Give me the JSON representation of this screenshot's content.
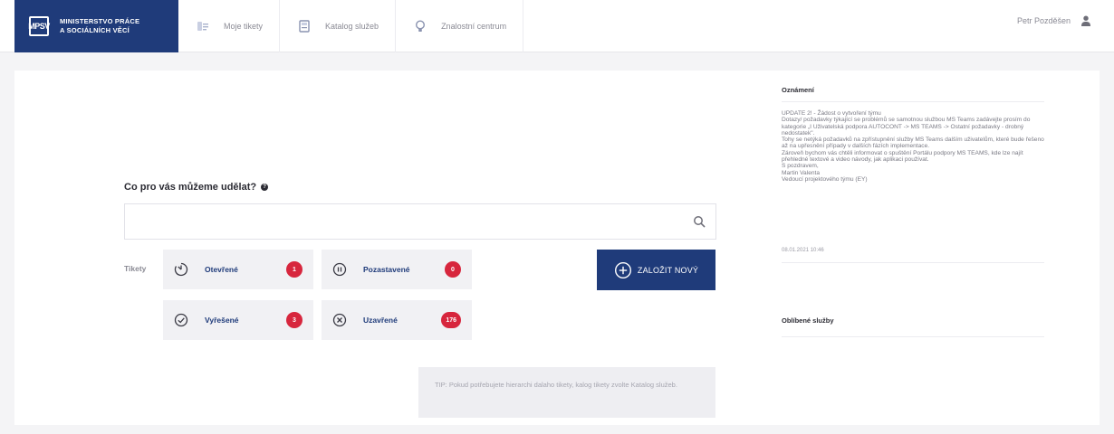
{
  "header": {
    "logo_mark": "MPSV",
    "logo_line1": "MINISTERSTVO PRÁCE",
    "logo_line2": "A SOCIÁLNÍCH VĚCÍ",
    "nav": [
      {
        "label": "Moje tikety",
        "icon": "tickets-icon"
      },
      {
        "label": "Katalog služeb",
        "icon": "catalog-icon"
      },
      {
        "label": "Znalostní centrum",
        "icon": "lightbulb-icon"
      }
    ],
    "user_name": "Petr Pozděšen",
    "user_icon": "user-icon"
  },
  "main": {
    "question": "Co pro vás můžeme udělat?",
    "search_placeholder": "",
    "tickets_label": "Tikety",
    "tiles": [
      {
        "label": "Otevřené",
        "count": "1",
        "icon": "clock-icon"
      },
      {
        "label": "Pozastavené",
        "count": "0",
        "icon": "pause-icon"
      },
      {
        "label": "Vyřešené",
        "count": "3",
        "icon": "check-icon"
      },
      {
        "label": "Uzavřené",
        "count": "176",
        "icon": "x-circle-icon"
      }
    ],
    "new_button": "ZALOŽIT NOVÝ",
    "tip": "TIP: Pokud potřebujete hierarchi dalaho tikety, kalog tikety zvolte Katalog služeb."
  },
  "side": {
    "announce_title": "Oznámení",
    "announce_text": "UPDATE 2! - Žádost o vytvoření týmu\nDotazy/ požadavky týkající se problémů se samotnou službou MS Teams zadávejte prosím do kategorie „I Uživatelská podpora AUTOCONT -> MS TEAMS -> Ostatní požadavky - drobný nedostatek\".\nTohy se netýká požadavků na zpřístupnění služby MS Teams dalším uživatelům, které bude řešeno až na upřesnění případy v dalších fázích implementace.\nZároveň bychom vás chtěli informovat o spuštění Portálu podpory MS TEAMS, kde lze najít přehledné textové a video návody, jak aplikaci používat.\nS pozdravem,\nMartin Valenta\nVedoucí projektového týmu (EY)",
    "announce_date": "08.01.2021 10:46",
    "favorites_title": "Oblíbené služby"
  },
  "colors": {
    "brand": "#1f3b7a",
    "badge": "#d7263d",
    "background": "#f4f4f6"
  }
}
